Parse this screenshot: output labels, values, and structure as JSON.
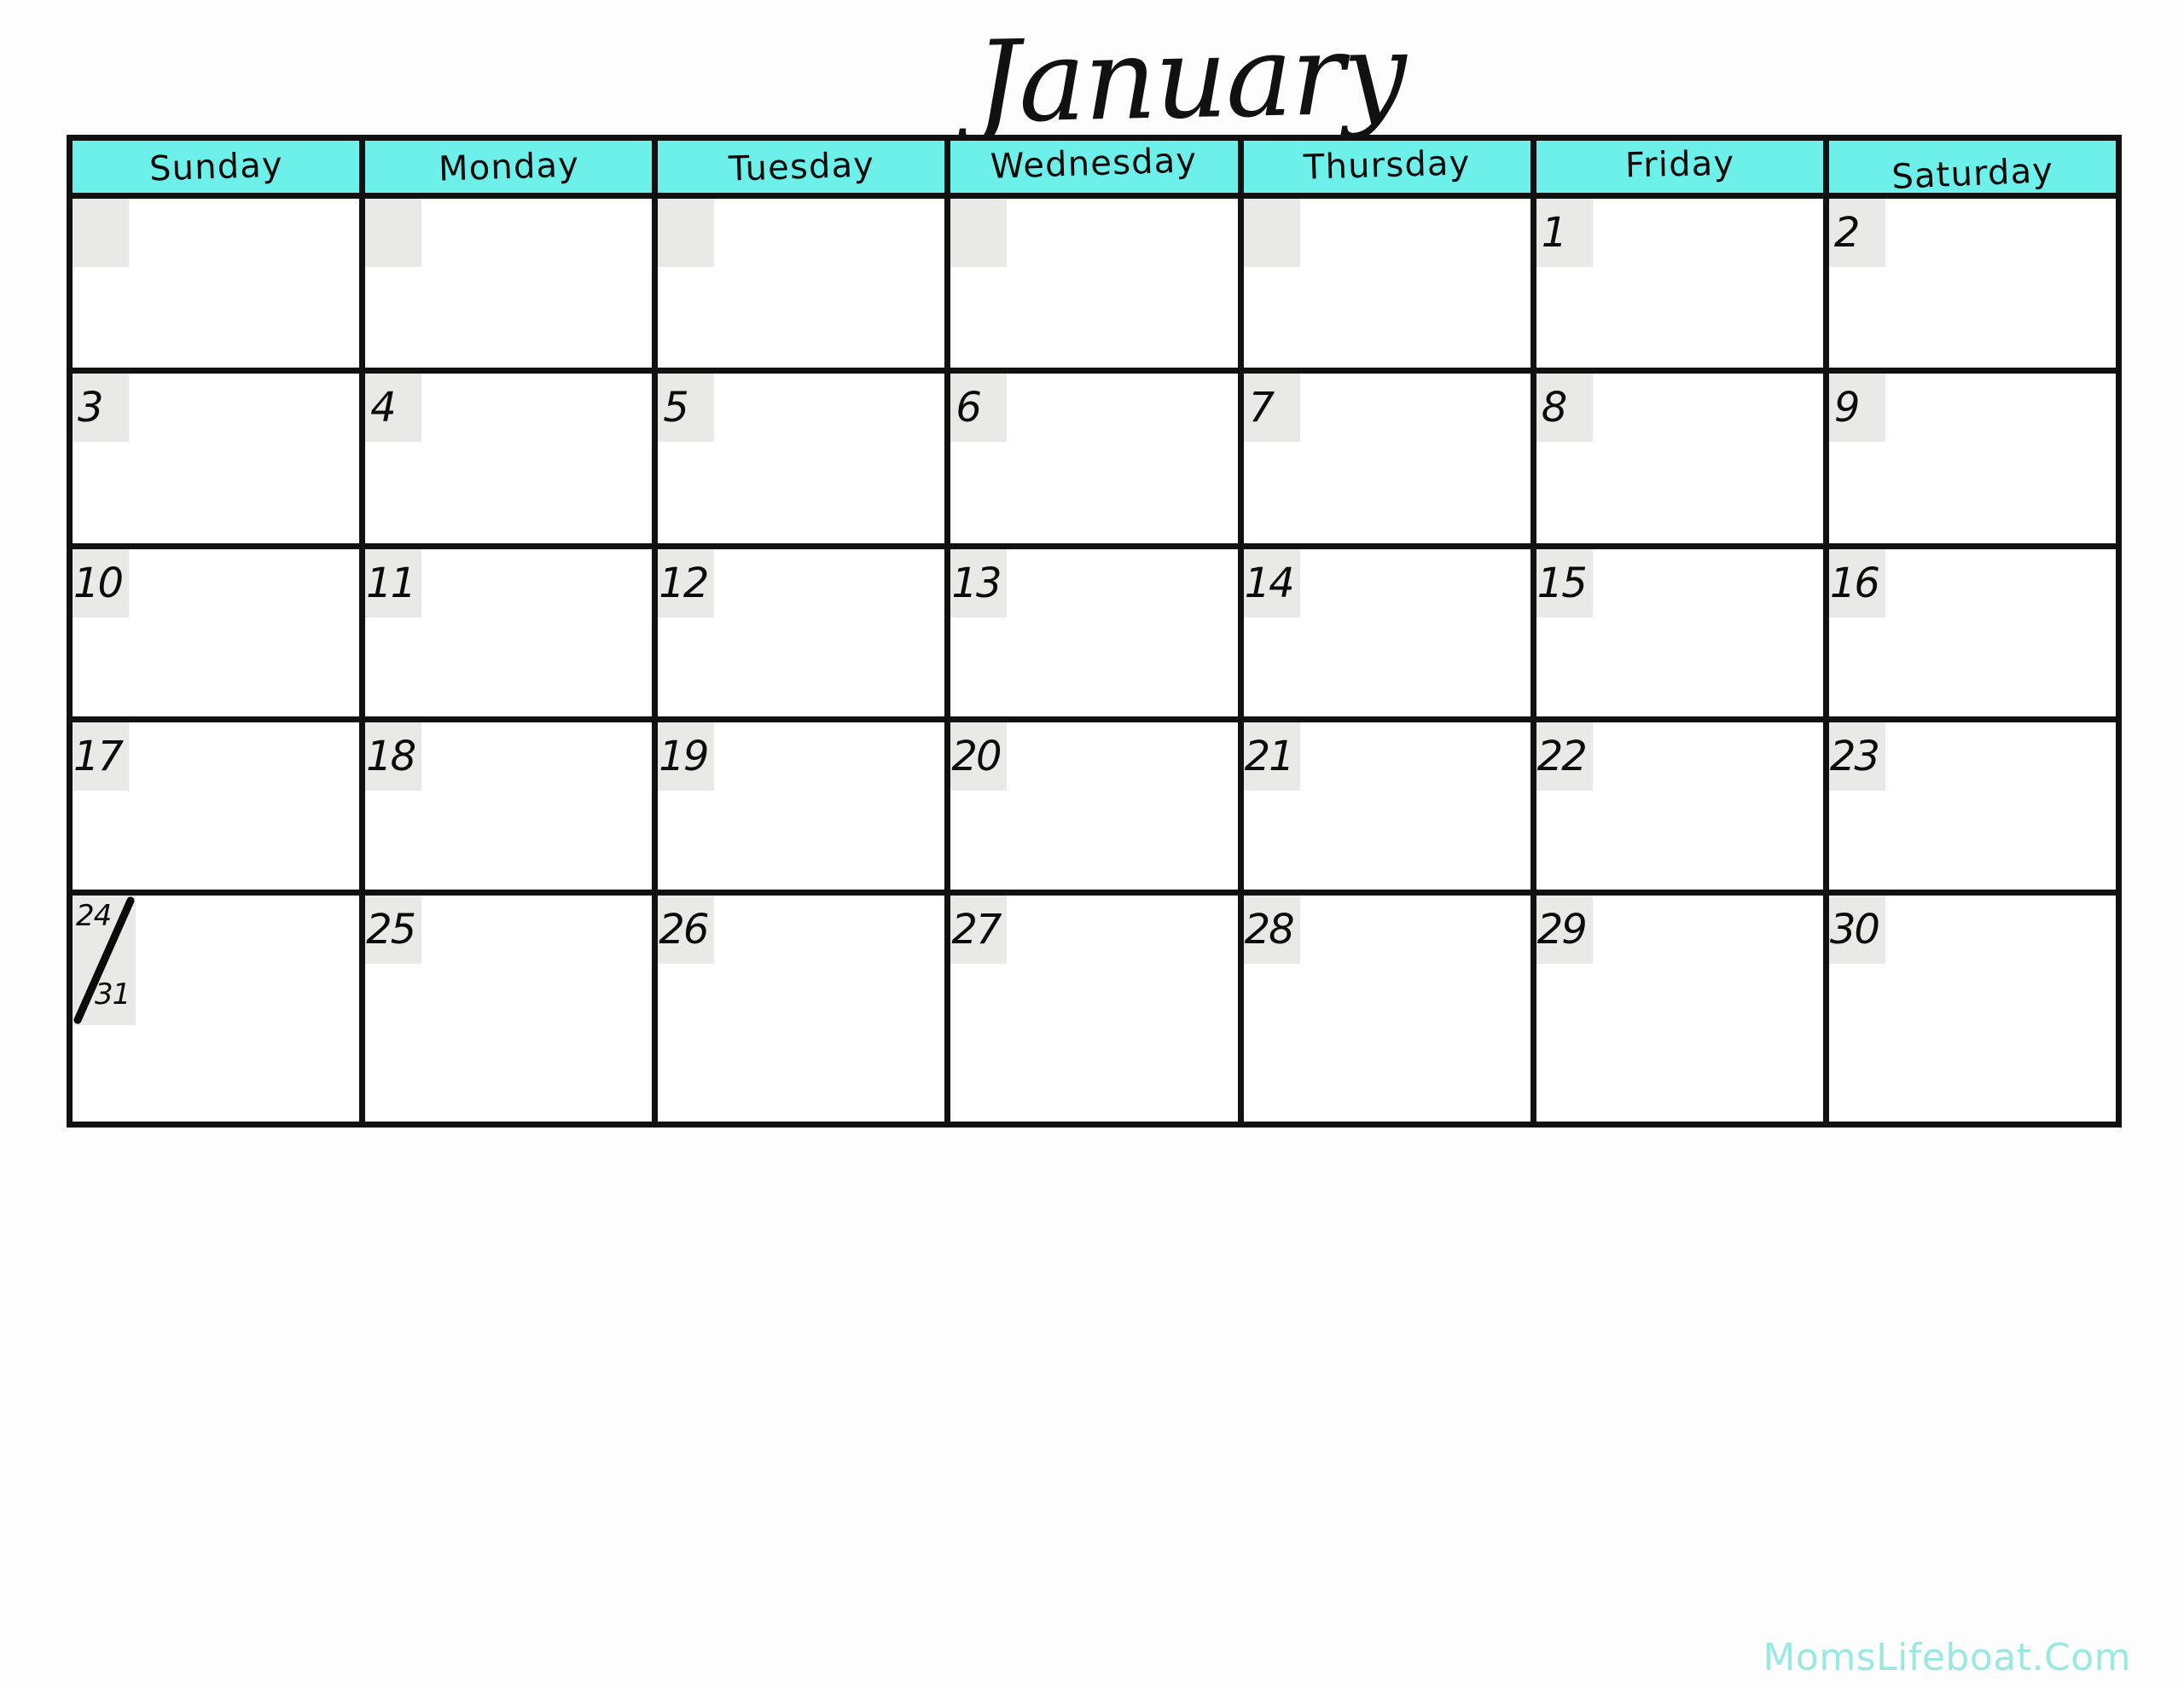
{
  "title": "January",
  "colors": {
    "header_bg": "#6DF0E9",
    "date_box_bg": "#E9E9E7",
    "grid_line": "#111111",
    "page_bg": "#FDFDFD",
    "watermark": "#9AE8E2",
    "text": "#0B0B0B"
  },
  "weekday_headers": [
    {
      "label": "Sunday"
    },
    {
      "label": "Monday"
    },
    {
      "label": "Tuesday"
    },
    {
      "label": "Wednesday"
    },
    {
      "label": "Thursday"
    },
    {
      "label": "Friday"
    },
    {
      "label": "Saturday"
    }
  ],
  "weeks": [
    {
      "days": [
        {
          "number": ""
        },
        {
          "number": ""
        },
        {
          "number": ""
        },
        {
          "number": ""
        },
        {
          "number": ""
        },
        {
          "number": "1"
        },
        {
          "number": "2"
        }
      ]
    },
    {
      "days": [
        {
          "number": "3"
        },
        {
          "number": "4"
        },
        {
          "number": "5"
        },
        {
          "number": "6"
        },
        {
          "number": "7"
        },
        {
          "number": "8"
        },
        {
          "number": "9"
        }
      ]
    },
    {
      "days": [
        {
          "number": "10"
        },
        {
          "number": "11"
        },
        {
          "number": "12"
        },
        {
          "number": "13"
        },
        {
          "number": "14"
        },
        {
          "number": "15"
        },
        {
          "number": "16"
        }
      ]
    },
    {
      "days": [
        {
          "number": "17"
        },
        {
          "number": "18"
        },
        {
          "number": "19"
        },
        {
          "number": "20"
        },
        {
          "number": "21"
        },
        {
          "number": "22"
        },
        {
          "number": "23"
        }
      ]
    },
    {
      "days": [
        {
          "number": "24",
          "number_secondary": "31",
          "split": true
        },
        {
          "number": "25"
        },
        {
          "number": "26"
        },
        {
          "number": "27"
        },
        {
          "number": "28"
        },
        {
          "number": "29"
        },
        {
          "number": "30"
        }
      ]
    }
  ],
  "watermark": "MomsLifeboat.Com"
}
